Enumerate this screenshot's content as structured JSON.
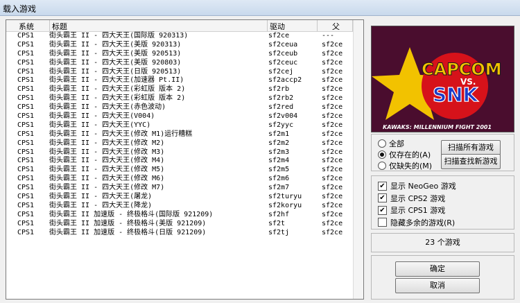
{
  "window": {
    "title": "载入游戏"
  },
  "table": {
    "headers": {
      "system": "系统",
      "title": "标题",
      "driver": "驱动",
      "parent": "父"
    },
    "rows": [
      {
        "system": "CPS1",
        "title": "街头霸王 II  -  四大天王(国际版 920313)",
        "driver": "sf2ce",
        "parent": "---"
      },
      {
        "system": "CPS1",
        "title": "街头霸王 II  -  四大天王(美版 920313)",
        "driver": "sf2ceua",
        "parent": "sf2ce"
      },
      {
        "system": "CPS1",
        "title": "街头霸王 II  -  四大天王(美版 920513)",
        "driver": "sf2ceub",
        "parent": "sf2ce"
      },
      {
        "system": "CPS1",
        "title": "街头霸王 II  -  四大天王(美版 920803)",
        "driver": "sf2ceuc",
        "parent": "sf2ce"
      },
      {
        "system": "CPS1",
        "title": "街头霸王 II  -  四大天王(日版 920513)",
        "driver": "sf2cej",
        "parent": "sf2ce"
      },
      {
        "system": "CPS1",
        "title": "街头霸王 II  -  四大天王(加速器 Pt.II)",
        "driver": "sf2accp2",
        "parent": "sf2ce"
      },
      {
        "system": "CPS1",
        "title": "街头霸王 II  -  四大天王(彩虹版 版本 2)",
        "driver": "sf2rb",
        "parent": "sf2ce"
      },
      {
        "system": "CPS1",
        "title": "街头霸王 II  -  四大天王(彩虹版 版本 2)",
        "driver": "sf2rb2",
        "parent": "sf2ce"
      },
      {
        "system": "CPS1",
        "title": "街头霸王 II  -  四大天王(赤色波动)",
        "driver": "sf2red",
        "parent": "sf2ce"
      },
      {
        "system": "CPS1",
        "title": "街头霸王 II  -  四大天王(V004)",
        "driver": "sf2v004",
        "parent": "sf2ce"
      },
      {
        "system": "CPS1",
        "title": "街头霸王 II  -  四大天王(YYC)",
        "driver": "sf2yyc",
        "parent": "sf2ce"
      },
      {
        "system": "CPS1",
        "title": "街头霸王 II  -  四大天王(修改 M1)运行糟糕",
        "driver": "sf2m1",
        "parent": "sf2ce"
      },
      {
        "system": "CPS1",
        "title": "街头霸王 II  -  四大天王(修改 M2)",
        "driver": "sf2m2",
        "parent": "sf2ce"
      },
      {
        "system": "CPS1",
        "title": "街头霸王 II  -  四大天王(修改 M3)",
        "driver": "sf2m3",
        "parent": "sf2ce"
      },
      {
        "system": "CPS1",
        "title": "街头霸王 II  -  四大天王(修改 M4)",
        "driver": "sf2m4",
        "parent": "sf2ce"
      },
      {
        "system": "CPS1",
        "title": "街头霸王 II  -  四大天王(修改 M5)",
        "driver": "sf2m5",
        "parent": "sf2ce"
      },
      {
        "system": "CPS1",
        "title": "街头霸王 II  -  四大天王(修改 M6)",
        "driver": "sf2m6",
        "parent": "sf2ce"
      },
      {
        "system": "CPS1",
        "title": "街头霸王 II  -  四大天王(修改 M7)",
        "driver": "sf2m7",
        "parent": "sf2ce"
      },
      {
        "system": "CPS1",
        "title": "街头霸王 II  -  四大天王(屠龙)",
        "driver": "sf2turyu",
        "parent": "sf2ce"
      },
      {
        "system": "CPS1",
        "title": "街头霸王 II  -  四大天王(降龙)",
        "driver": "sf2koryu",
        "parent": "sf2ce"
      },
      {
        "system": "CPS1",
        "title": "街头霸王 II 加速版 - 终极格斗(国际版 921209)",
        "driver": "sf2hf",
        "parent": "sf2ce"
      },
      {
        "system": "CPS1",
        "title": "街头霸王 II 加速版 - 终极格斗(美版 921209)",
        "driver": "sf2t",
        "parent": "sf2ce"
      },
      {
        "system": "CPS1",
        "title": "街头霸王 II 加速版 - 终极格斗(日版 921209)",
        "driver": "sf2tj",
        "parent": "sf2ce"
      }
    ]
  },
  "preview": {
    "logo_text_1": "CAPCOM",
    "logo_text_vs": "VS.",
    "logo_text_2": "SNK",
    "logo_subtitle": "KAWAKS: MILLENNIUM FIGHT 2001",
    "colors": {
      "bg": "#4a0d2e",
      "gold": "#f2c200",
      "red": "#d6121a",
      "blue": "#1a3cc8"
    }
  },
  "filters": {
    "radio_all": "全部",
    "radio_existing": "仅存在的(A)",
    "radio_missing": "仅缺失的(M)",
    "selected": "radio_existing",
    "scan_all_button": "扫描所有游戏",
    "scan_new_button": "扫描查找新游戏"
  },
  "options": [
    {
      "label": "显示 NeoGeo 游戏",
      "checked": true
    },
    {
      "label": "显示 CPS2 游戏",
      "checked": true
    },
    {
      "label": "显示 CPS1 游戏",
      "checked": true
    },
    {
      "label": "隐藏多余的游戏(R)",
      "checked": false
    }
  ],
  "status": {
    "count_text": "23 个游戏"
  },
  "actions": {
    "ok_button": "确定",
    "cancel_button": "取消"
  }
}
